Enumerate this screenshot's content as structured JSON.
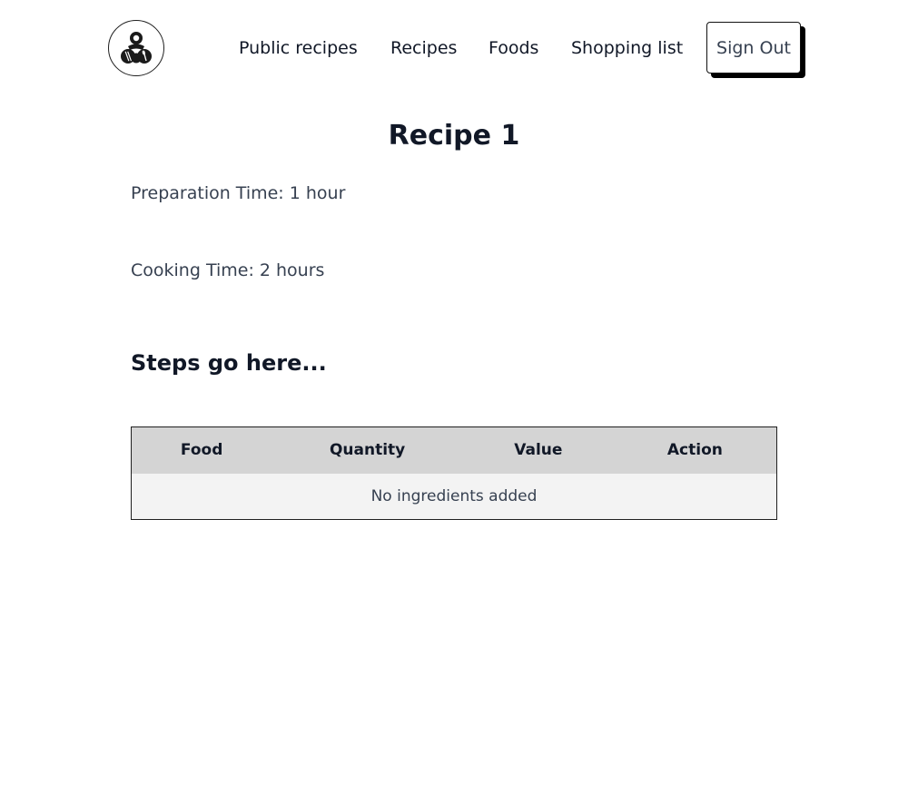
{
  "nav": {
    "logo_icon": "chef-utensils-logo-icon",
    "links": [
      {
        "label": "Public recipes"
      },
      {
        "label": "Recipes"
      },
      {
        "label": "Foods"
      },
      {
        "label": "Shopping list"
      }
    ],
    "sign_out_label": "Sign Out"
  },
  "recipe": {
    "title": "Recipe 1",
    "preparation_time": "Preparation Time: 1 hour",
    "cooking_time": "Cooking Time: 2 hours",
    "steps_text": "Steps go here..."
  },
  "ingredients_table": {
    "headers": [
      "Food",
      "Quantity",
      "Value",
      "Action"
    ],
    "empty_message": "No ingredients added"
  },
  "colors": {
    "text_dark": "#111827",
    "text_muted": "#374151",
    "table_header_bg": "#d4d4d4",
    "table_row_bg": "#f3f3f3"
  }
}
